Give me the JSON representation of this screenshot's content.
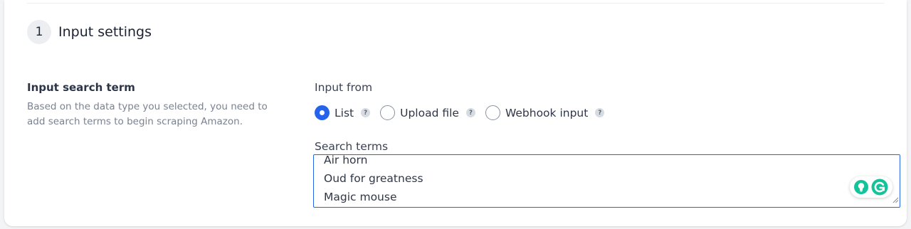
{
  "section": {
    "step_number": "1",
    "title": "Input settings"
  },
  "input_search_term": {
    "title": "Input search term",
    "description": "Based on the data type you selected, you need to add search terms to begin scraping Amazon."
  },
  "input_from": {
    "label": "Input from",
    "options": [
      {
        "label": "List",
        "checked": true,
        "help": "?"
      },
      {
        "label": "Upload file",
        "checked": false,
        "help": "?"
      },
      {
        "label": "Webhook input",
        "checked": false,
        "help": "?"
      }
    ]
  },
  "search_terms": {
    "label": "Search terms",
    "lines": [
      "Air horn",
      "Oud for greatness",
      "Magic mouse"
    ]
  },
  "colors": {
    "accent": "#2563eb",
    "grammarly_green": "#15c39a"
  }
}
